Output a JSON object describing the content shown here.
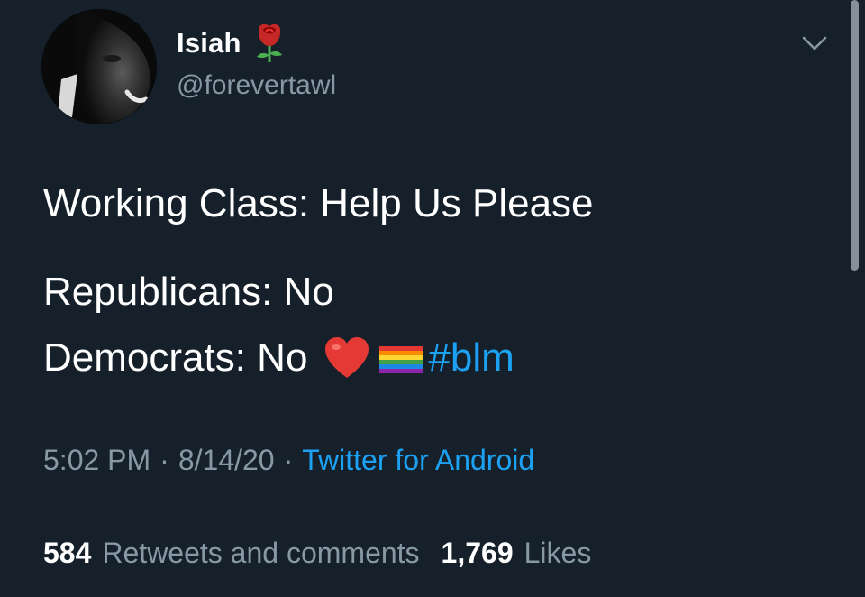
{
  "user": {
    "display_name": "Isiah",
    "handle": "@forevertawl",
    "name_emoji": "rose-icon"
  },
  "tweet": {
    "lines": [
      "Working Class: Help Us Please",
      "Republicans: No",
      "Democrats: No"
    ],
    "emojis": [
      "heart-icon",
      "rainbow-flag-icon"
    ],
    "hashtag": "#blm"
  },
  "meta": {
    "time": "5:02 PM",
    "separator": "·",
    "date": "8/14/20",
    "source": "Twitter for Android"
  },
  "stats": {
    "retweets_count": "584",
    "retweets_label": "Retweets and comments",
    "likes_count": "1,769",
    "likes_label": "Likes"
  },
  "colors": {
    "background": "#15202b",
    "primary_text": "#ffffff",
    "secondary_text": "#8899a6",
    "link": "#1da1f2",
    "divider": "#38444d"
  }
}
